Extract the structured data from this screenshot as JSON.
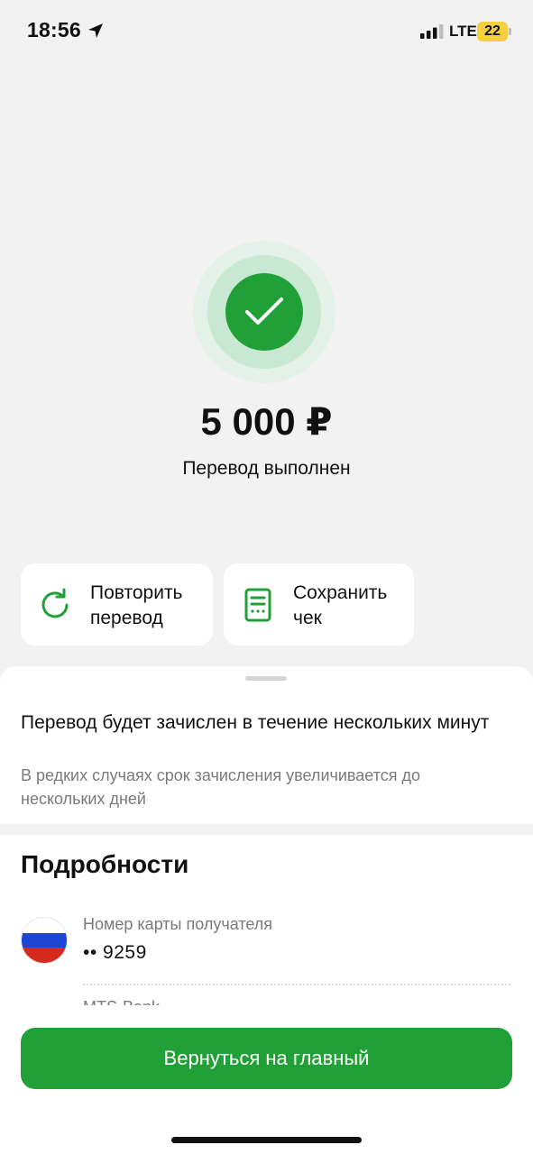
{
  "status_bar": {
    "time": "18:56",
    "network": "LTE",
    "battery": "22"
  },
  "success": {
    "amount": "5 000 ₽",
    "status": "Перевод выполнен"
  },
  "actions": {
    "repeat_label": "Повторить\nперевод",
    "save_label": "Сохранить\nчек"
  },
  "notice": {
    "title": "Перевод будет зачислен в течение нескольких минут",
    "subtitle": "В редких случаях срок зачисления увеличивается до нескольких дней"
  },
  "details": {
    "title": "Подробности",
    "card_label": "Номер карты получателя",
    "card_value": "•• 9259",
    "bank_label": "MTS-Bank"
  },
  "button": {
    "label": "Вернуться на главный"
  },
  "colors": {
    "accent": "#21a038",
    "background": "#f2f2f2",
    "secondary_text": "#7a7a7a"
  },
  "icons": {
    "location": "location-arrow-icon",
    "signal": "cellular-signal-icon",
    "success": "checkmark-icon",
    "repeat": "refresh-icon",
    "save": "receipt-icon",
    "flag": "russia-flag-icon"
  }
}
